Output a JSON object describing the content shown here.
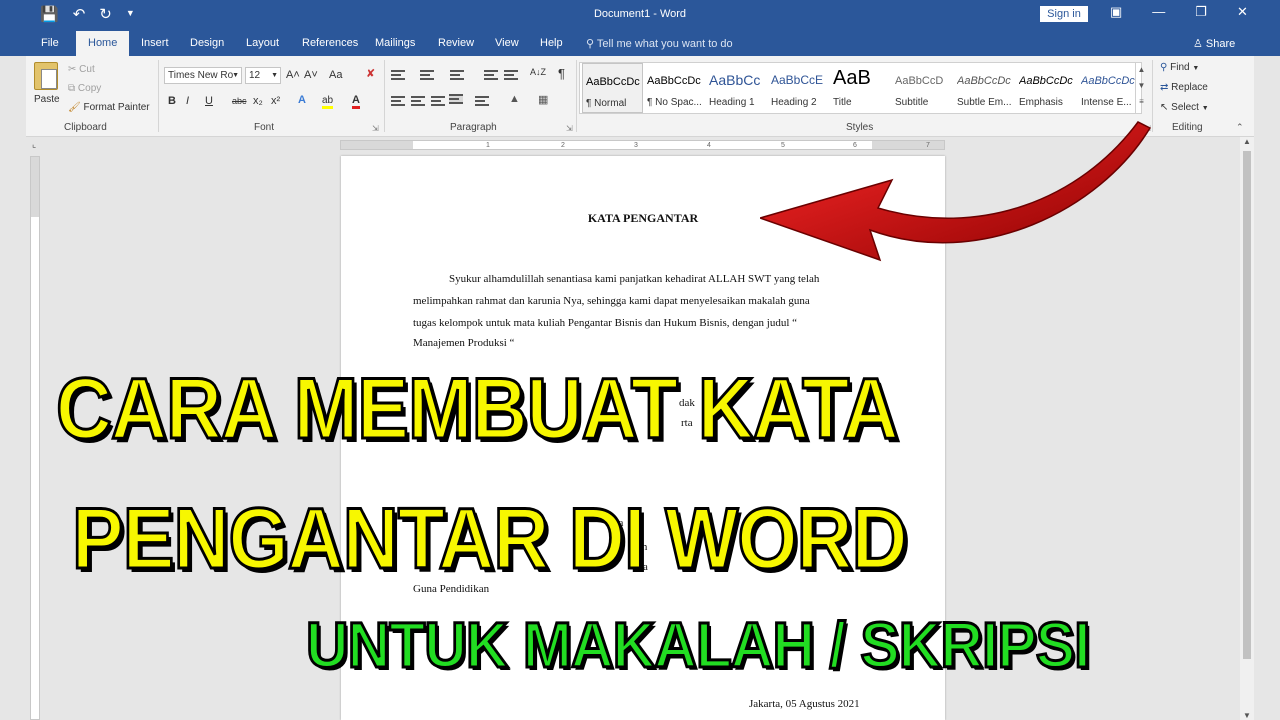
{
  "window": {
    "title": "Document1  -  Word",
    "sign_in": "Sign in"
  },
  "qat": {
    "save_icon": "save-icon",
    "undo_icon": "undo-icon",
    "redo_icon": "redo-icon",
    "customize_icon": "customize-icon"
  },
  "tabs": [
    {
      "label": "File"
    },
    {
      "label": "Home"
    },
    {
      "label": "Insert"
    },
    {
      "label": "Design"
    },
    {
      "label": "Layout"
    },
    {
      "label": "References"
    },
    {
      "label": "Mailings"
    },
    {
      "label": "Review"
    },
    {
      "label": "View"
    },
    {
      "label": "Help"
    }
  ],
  "tell_me": "Tell me what you want to do",
  "share": "Share",
  "clipboard": {
    "paste": "Paste",
    "cut": "Cut",
    "copy": "Copy",
    "format_painter": "Format Painter",
    "group": "Clipboard"
  },
  "font": {
    "name": "Times New Ro",
    "size": "12",
    "group": "Font",
    "bold": "B",
    "italic": "I",
    "underline": "U",
    "strike": "abc",
    "sub": "x₂",
    "sup": "x²",
    "grow": "A˄",
    "shrink": "A˅",
    "case": "Aa",
    "text_effects": "A",
    "highlight": "ab",
    "font_color": "A"
  },
  "paragraph": {
    "group": "Paragraph",
    "sort": "A↓Z",
    "pilcrow": "¶"
  },
  "styles": {
    "group": "Styles",
    "items": [
      {
        "preview": "AaBbCcDc",
        "name": "¶ Normal"
      },
      {
        "preview": "AaBbCcDc",
        "name": "¶ No Spac..."
      },
      {
        "preview": "AaBbCc",
        "name": "Heading 1"
      },
      {
        "preview": "AaBbCcE",
        "name": "Heading 2"
      },
      {
        "preview": "AaB",
        "name": "Title"
      },
      {
        "preview": "AaBbCcD",
        "name": "Subtitle"
      },
      {
        "preview": "AaBbCcDc",
        "name": "Subtle Em..."
      },
      {
        "preview": "AaBbCcDc",
        "name": "Emphasis"
      },
      {
        "preview": "AaBbCcDc",
        "name": "Intense E..."
      }
    ]
  },
  "editing": {
    "find": "Find",
    "replace": "Replace",
    "select": "Select",
    "group": "Editing"
  },
  "ruler": {
    "ticks": [
      "1",
      "2",
      "3",
      "4",
      "5",
      "6",
      "7"
    ]
  },
  "document": {
    "heading": "KATA PENGANTAR",
    "p1_line1": "Syukur alhamdulillah senantiasa kami panjatkan kehadirat ALLAH SWT yang telah",
    "p1_line2": "melimpahkan rahmat dan karunia Nya, sehingga kami dapat menyelesaikan makalah guna",
    "p1_line3": "tugas kelompok untuk mata kuliah Pengantar Bisnis dan Hukum Bisnis, dengan judul “",
    "p1_line4": "Manajemen Produksi “",
    "fragment_1": "dak",
    "fragment_2": "rta",
    "fragment_3": "ya",
    "fragment_4": "an",
    "fragment_5": "ala",
    "fragment_6": "Guna Pendidikan",
    "signoff": "Jakarta, 05 Agustus 2021"
  },
  "overlay": {
    "line1": "CARA MEMBUAT KATA",
    "line2": "PENGANTAR DI WORD",
    "line3": "UNTUK MAKALAH / SKRIPSI",
    "colors": {
      "yellow": "#f7f700",
      "green": "#22dd22",
      "outline": "#000000",
      "arrow": "#d40000"
    }
  },
  "colors": {
    "ribbon_blue": "#2b579a",
    "ribbon_bg": "#f3f3f3",
    "workspace": "#e6e6e6"
  }
}
